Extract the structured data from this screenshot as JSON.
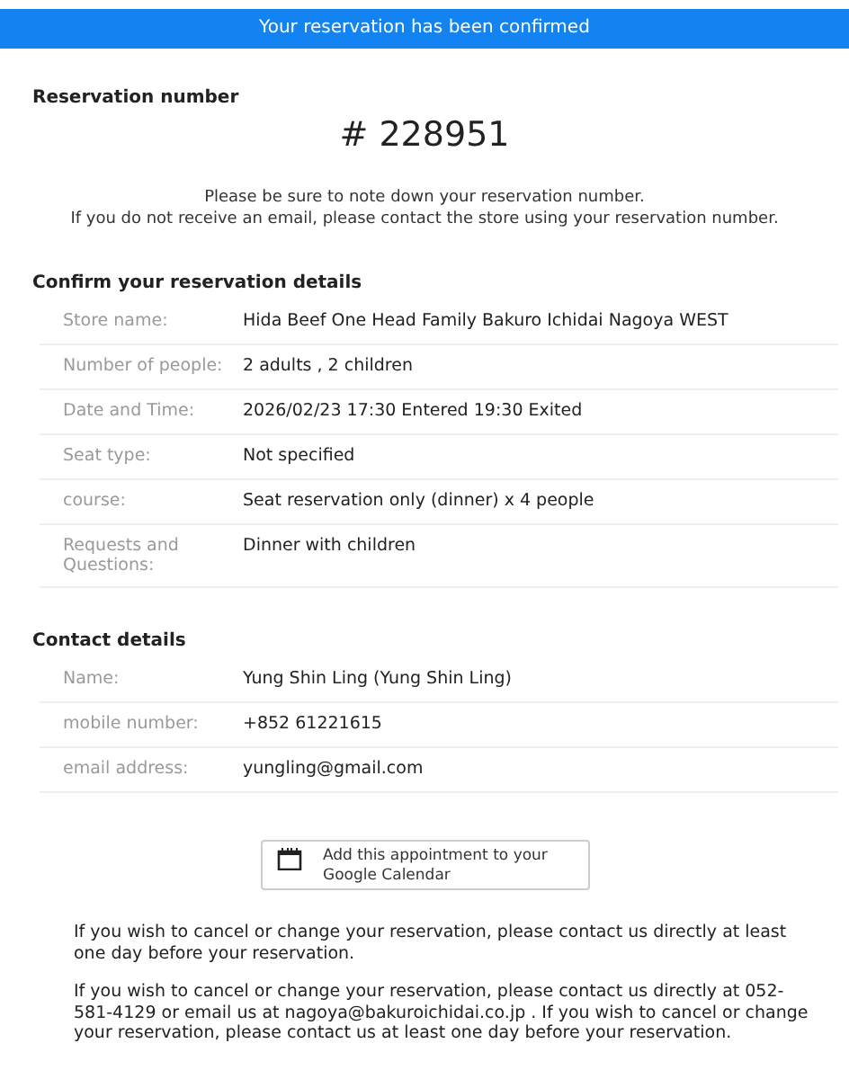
{
  "banner": {
    "text": "Your reservation has been confirmed"
  },
  "reservation": {
    "heading": "Reservation number",
    "number": "# 228951",
    "notes": [
      "Please be sure to note down your reservation number.",
      "If you do not receive an email, please contact the store using your reservation number."
    ]
  },
  "details": {
    "heading": "Confirm your reservation details",
    "rows": [
      {
        "label": "Store name:",
        "value": "Hida Beef One Head Family Bakuro Ichidai Nagoya WEST"
      },
      {
        "label": "Number of people:",
        "value": "2 adults , 2 children"
      },
      {
        "label": "Date and Time:",
        "value": "2026/02/23 17:30 Entered 19:30 Exited"
      },
      {
        "label": "Seat type:",
        "value": "Not specified"
      },
      {
        "label": "course:",
        "value": "Seat reservation only (dinner) x 4 people"
      },
      {
        "label": "Requests and Questions:",
        "value": "Dinner with children"
      }
    ]
  },
  "contact": {
    "heading": "Contact details",
    "rows": [
      {
        "label": "Name:",
        "value": "Yung Shin Ling (Yung Shin Ling)"
      },
      {
        "label": "mobile number:",
        "value": "+852 61221615"
      },
      {
        "label": "email address:",
        "value": "yungling@gmail.com"
      }
    ]
  },
  "calendar_button": {
    "label": "Add this appointment to your Google Calendar"
  },
  "policy": [
    {
      "text": "If you wish to cancel or change your reservation, please contact us directly at least one day before your reservation."
    },
    {
      "text": "If you wish to cancel or change your reservation, please contact us directly at 052-581-4129 or email us at",
      "email": "nagoya@bakuroichidai.co.jp",
      "after": " . If you wish to cancel or change your reservation, please contact us at least one day before your reservation."
    }
  ]
}
